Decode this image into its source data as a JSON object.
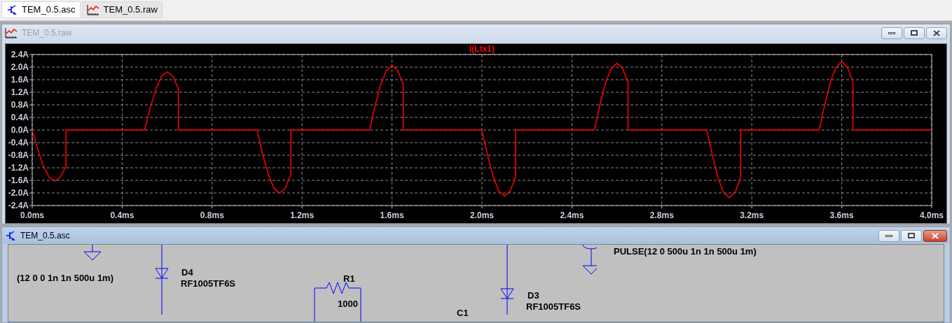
{
  "tabs": [
    {
      "label": "TEM_0.5.asc",
      "kind": "schematic",
      "selected": true
    },
    {
      "label": "TEM_0.5.raw",
      "kind": "waveform",
      "selected": false
    }
  ],
  "plot_window": {
    "title": "TEM_0.5.raw",
    "active": false,
    "chart_data": {
      "type": "line",
      "grid": true,
      "x": [
        0,
        0.025,
        0.05,
        0.075,
        0.1,
        0.125,
        0.15,
        0.15,
        0.5,
        0.525,
        0.55,
        0.575,
        0.6,
        0.625,
        0.65,
        0.65,
        1.0,
        1.025,
        1.05,
        1.075,
        1.1,
        1.125,
        1.15,
        1.15,
        1.5,
        1.525,
        1.55,
        1.575,
        1.6,
        1.625,
        1.65,
        1.65,
        2.0,
        2.025,
        2.05,
        2.075,
        2.1,
        2.125,
        2.15,
        2.15,
        2.5,
        2.525,
        2.55,
        2.575,
        2.6,
        2.625,
        2.65,
        2.65,
        3.0,
        3.025,
        3.05,
        3.075,
        3.1,
        3.125,
        3.15,
        3.15,
        3.5,
        3.525,
        3.55,
        3.575,
        3.6,
        3.625,
        3.65,
        3.65,
        4.0
      ],
      "series": [
        {
          "name": "I(Ltx1)",
          "color": "#ff0000",
          "values": [
            0,
            -0.62,
            -1.15,
            -1.5,
            -1.62,
            -1.5,
            -1.15,
            0,
            0,
            0.71,
            1.31,
            1.71,
            1.85,
            1.71,
            1.31,
            0,
            0,
            -0.77,
            -1.41,
            -1.85,
            -2.0,
            -1.85,
            -1.41,
            0,
            0,
            0.78,
            1.45,
            1.89,
            2.05,
            1.89,
            1.45,
            0,
            0,
            -0.8,
            -1.48,
            -1.94,
            -2.1,
            -1.94,
            -1.48,
            0,
            0,
            0.81,
            1.5,
            1.96,
            2.12,
            1.96,
            1.5,
            0,
            0,
            -0.82,
            -1.52,
            -1.99,
            -2.15,
            -1.99,
            -1.52,
            0,
            0,
            0.83,
            1.53,
            2.0,
            2.17,
            2.0,
            1.53,
            0,
            0
          ]
        }
      ],
      "xlim": [
        0,
        4
      ],
      "ylim": [
        -2.4,
        2.4
      ],
      "xticks": [
        {
          "value": 0,
          "label": "0.0ms"
        },
        {
          "value": 0.4,
          "label": "0.4ms"
        },
        {
          "value": 0.8,
          "label": "0.8ms"
        },
        {
          "value": 1.2,
          "label": "1.2ms"
        },
        {
          "value": 1.6,
          "label": "1.6ms"
        },
        {
          "value": 2.0,
          "label": "2.0ms"
        },
        {
          "value": 2.4,
          "label": "2.4ms"
        },
        {
          "value": 2.8,
          "label": "2.8ms"
        },
        {
          "value": 3.2,
          "label": "3.2ms"
        },
        {
          "value": 3.6,
          "label": "3.6ms"
        },
        {
          "value": 4.0,
          "label": "4.0ms"
        }
      ],
      "yticks": [
        {
          "value": 2.4,
          "label": "2.4A"
        },
        {
          "value": 2.0,
          "label": "2.0A"
        },
        {
          "value": 1.6,
          "label": "1.6A"
        },
        {
          "value": 1.2,
          "label": "1.2A"
        },
        {
          "value": 0.8,
          "label": "0.8A"
        },
        {
          "value": 0.4,
          "label": "0.4A"
        },
        {
          "value": 0,
          "label": "0.0A"
        },
        {
          "value": -0.4,
          "label": "-0.4A"
        },
        {
          "value": -0.8,
          "label": "-0.8A"
        },
        {
          "value": -1.2,
          "label": "-1.2A"
        },
        {
          "value": -1.6,
          "label": "-1.6A"
        },
        {
          "value": -2.0,
          "label": "-2.0A"
        },
        {
          "value": -2.4,
          "label": "-2.4A"
        }
      ]
    }
  },
  "schematic_window": {
    "title": "TEM_0.5.asc",
    "active": true,
    "labels": [
      "(12 0 0 1n 1n 500u 1m)",
      "D4",
      "RF1005TF6S",
      "R1",
      "1000",
      "PULSE(12 0 500u 1n 1n 500u 1m)",
      "D3",
      "RF1005TF6S",
      "C1"
    ]
  }
}
